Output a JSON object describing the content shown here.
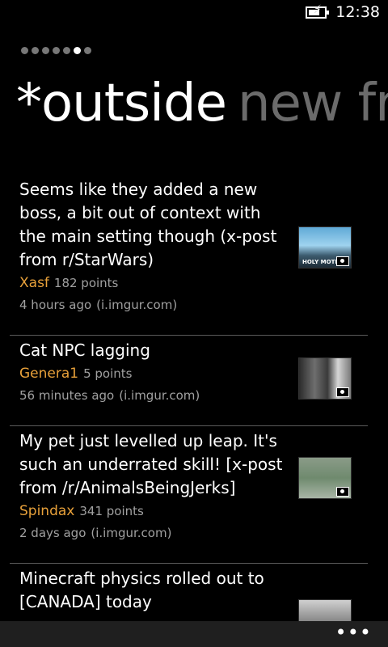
{
  "status": {
    "time": "12:38",
    "battery_level": 0.7
  },
  "pivot": {
    "page_count": 7,
    "active_index": 5,
    "current": "*outside",
    "next": "new fr"
  },
  "posts": [
    {
      "title": "Seems like they added a new boss, a bit out of context with the main setting though (x-post from r/StarWars)",
      "author": "Xasf",
      "points": "182 points",
      "age": "4 hours ago",
      "domain": "(i.imgur.com)",
      "thumb_caption": "HOLY MOTHER"
    },
    {
      "title": "Cat NPC lagging",
      "author": "Genera1",
      "points": "5 points",
      "age": "56 minutes ago",
      "domain": "(i.imgur.com)"
    },
    {
      "title": "My pet just levelled up leap. It's such an underrated skill! [x-post from /r/AnimalsBeingJerks]",
      "author": "Spindax",
      "points": "341 points",
      "age": "2 days ago",
      "domain": "(i.imgur.com)"
    },
    {
      "title": "Minecraft physics rolled out to [CANADA] today"
    }
  ],
  "app_bar": {
    "more": "•••"
  },
  "colors": {
    "author": "#e8a13a",
    "background": "#000000",
    "inactive_header": "#6b6b6b"
  }
}
